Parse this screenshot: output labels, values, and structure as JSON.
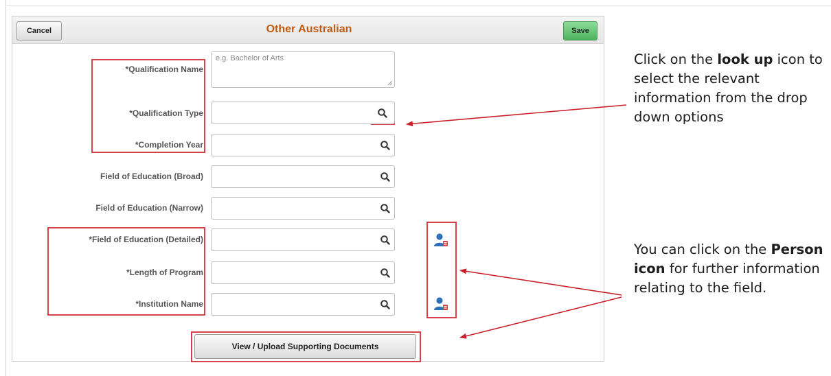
{
  "toolbar": {
    "cancel_label": "Cancel",
    "title": "Other Australian",
    "save_label": "Save"
  },
  "form": {
    "qualification_name": {
      "label": "*Qualification Name",
      "placeholder": "e.g. Bachelor of Arts"
    },
    "qualification_type": {
      "label": "*Qualification Type"
    },
    "completion_year": {
      "label": "*Completion Year"
    },
    "field_broad": {
      "label": "Field of Education (Broad)"
    },
    "field_narrow": {
      "label": "Field of Education (Narrow)"
    },
    "field_detailed": {
      "label": "*Field of Education (Detailed)"
    },
    "length_program": {
      "label": "*Length of Program"
    },
    "institution_name": {
      "label": "*Institution Name"
    }
  },
  "documents_button_label": "View / Upload Supporting Documents",
  "annotations": {
    "lookup_note": {
      "prefix": "Click on the ",
      "bold": "look up",
      "suffix": " icon to select the relevant information from the drop down options"
    },
    "person_note": {
      "prefix": "You can click on the ",
      "bold": "Person icon",
      "suffix": " for further information relating to the field."
    }
  },
  "colors": {
    "title": "#c15a10",
    "highlight": "#d9414a",
    "save_button": "#5cbf6c",
    "person_icon": "#2f6fb3"
  },
  "icons": [
    "search-icon",
    "person-icon"
  ]
}
